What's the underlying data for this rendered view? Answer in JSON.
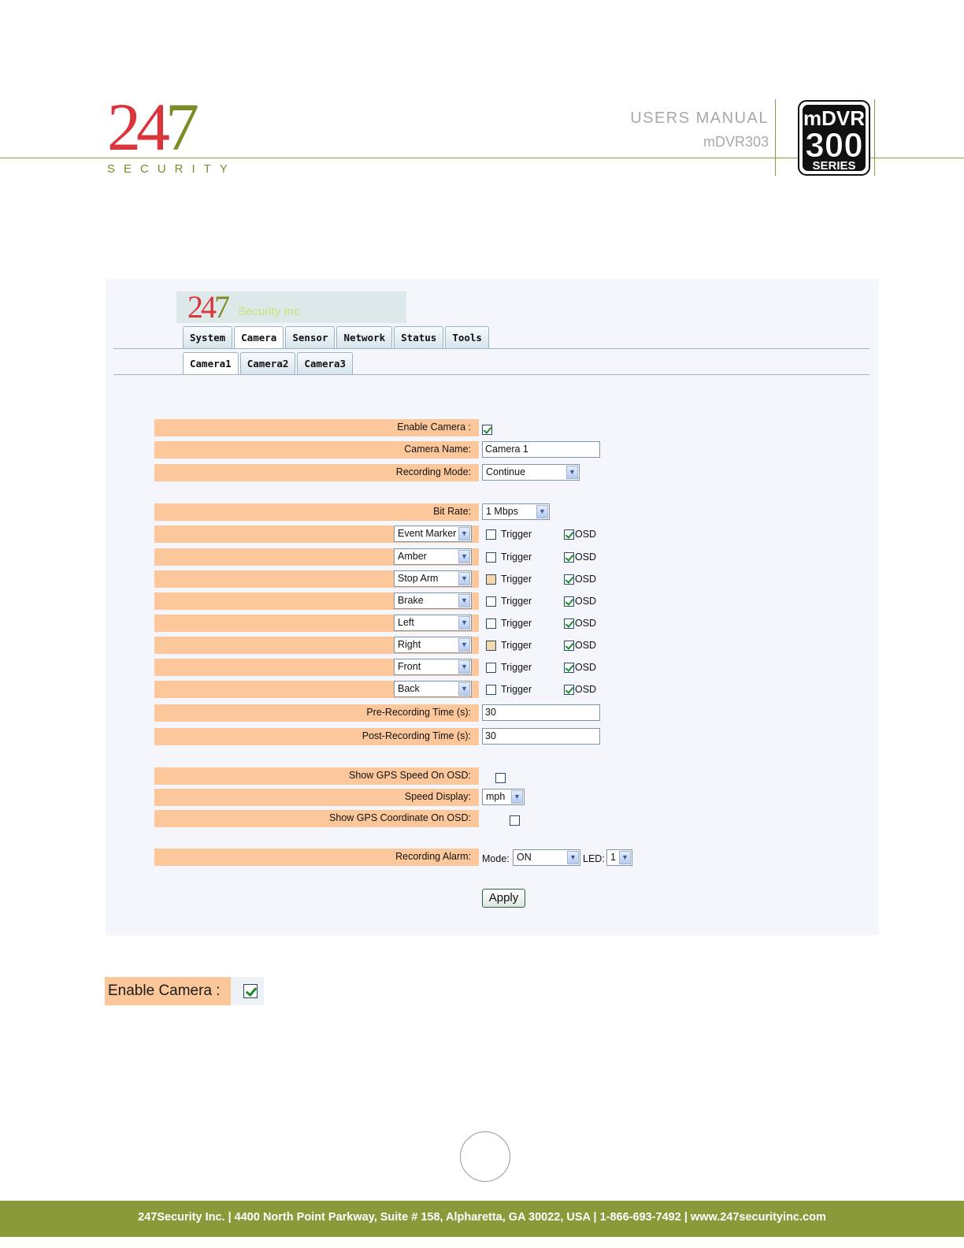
{
  "header": {
    "logo_number_red": "24",
    "logo_number_green": "7",
    "logo_sub": "SECURITY",
    "title": "USERS MANUAL",
    "model": "mDVR303",
    "series_logo_top": "mDVR",
    "series_logo_mid": "300",
    "series_logo_bot": "SERIES"
  },
  "screenshot": {
    "banner": {
      "num_red": "24",
      "num_green": "7",
      "text": "Security Inc"
    },
    "tabs": [
      "System",
      "Camera",
      "Sensor",
      "Network",
      "Status",
      "Tools"
    ],
    "active_tab": "Camera",
    "subtabs": [
      "Camera1",
      "Camera2",
      "Camera3"
    ],
    "active_subtab": "Camera1",
    "enable_camera": {
      "label": "Enable Camera :",
      "checked": true
    },
    "camera_name": {
      "label": "Camera Name:",
      "value": "Camera 1"
    },
    "recording_mode": {
      "label": "Recording Mode:",
      "value": "Continue"
    },
    "bit_rate": {
      "label": "Bit Rate:",
      "value": "1 Mbps"
    },
    "sensors": [
      {
        "name": "Event Marker",
        "trigger_label": "Trigger",
        "osd_label": "OSD",
        "trigger": false,
        "osd": true
      },
      {
        "name": "Amber",
        "trigger_label": "Trigger",
        "osd_label": "OSD",
        "trigger": false,
        "osd": true
      },
      {
        "name": "Stop Arm",
        "trigger_label": "Trigger",
        "osd_label": "OSD",
        "trigger": false,
        "osd": true
      },
      {
        "name": "Brake",
        "trigger_label": "Trigger",
        "osd_label": "OSD",
        "trigger": false,
        "osd": true
      },
      {
        "name": "Left",
        "trigger_label": "Trigger",
        "osd_label": "OSD",
        "trigger": false,
        "osd": true
      },
      {
        "name": "Right",
        "trigger_label": "Trigger",
        "osd_label": "OSD",
        "trigger": false,
        "osd": true
      },
      {
        "name": "Front",
        "trigger_label": "Trigger",
        "osd_label": "OSD",
        "trigger": false,
        "osd": true
      },
      {
        "name": "Back",
        "trigger_label": "Trigger",
        "osd_label": "OSD",
        "trigger": false,
        "osd": true
      }
    ],
    "pre_recording": {
      "label": "Pre-Recording Time (s):",
      "value": "30"
    },
    "post_recording": {
      "label": "Post-Recording Time (s):",
      "value": "30"
    },
    "gps_speed": {
      "label": "Show GPS Speed On OSD:",
      "checked": false
    },
    "speed_display": {
      "label": "Speed Display:",
      "value": "mph"
    },
    "gps_coord": {
      "label": "Show GPS Coordinate On OSD:",
      "checked": false
    },
    "recording_alarm": {
      "label": "Recording Alarm:",
      "mode_label": "Mode:",
      "mode_value": "ON",
      "led_label": "LED:",
      "led_value": "1"
    },
    "apply_label": "Apply"
  },
  "zoom": {
    "label": "Enable Camera :",
    "checked": true
  },
  "footer": {
    "text": "247Security Inc. | 4400 North Point Parkway, Suite # 158, Alpharetta, GA  30022,  USA  | 1-866-693-7492  | www.247securityinc.com"
  },
  "colors": {
    "brand_green": "#8a9a3b",
    "brand_red": "#d9363c",
    "label_bg": "#fcc89b",
    "panel_bg": "#f4f6fb"
  }
}
